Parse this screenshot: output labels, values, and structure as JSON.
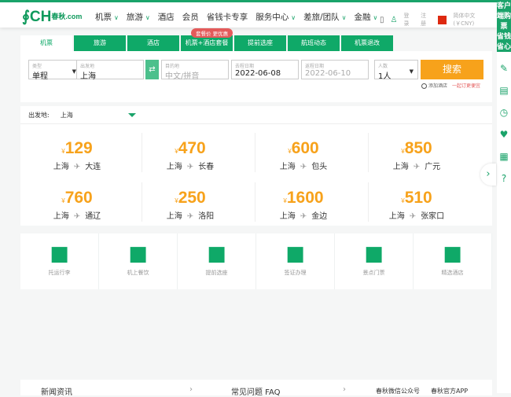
{
  "header": {
    "logo_text": "CH",
    "logo_sub": "春秋.com",
    "nav": [
      {
        "label": "机票",
        "dropdown": true
      },
      {
        "label": "旅游",
        "dropdown": true
      },
      {
        "label": "酒店"
      },
      {
        "label": "会员"
      },
      {
        "label": "省钱卡专享"
      },
      {
        "label": "服务中心",
        "dropdown": true
      },
      {
        "label": "差旅/团队",
        "dropdown": true
      },
      {
        "label": "金融",
        "dropdown": true
      }
    ],
    "login": "登录",
    "register": "注册",
    "language": "简体中文 (￥CNY)"
  },
  "sidebar": {
    "promo": "客户端购票 省钱省心"
  },
  "tabs": [
    {
      "label": "机票",
      "active": true
    },
    {
      "label": "旅游"
    },
    {
      "label": "酒店"
    },
    {
      "label": "机票+酒店套餐"
    },
    {
      "label": "提前选座"
    },
    {
      "label": "航班动态"
    },
    {
      "label": "机票退改"
    }
  ],
  "tab_badge": "套餐价 更优惠",
  "form": {
    "type_label": "类型",
    "type_value": "单程",
    "from_label": "出发地",
    "from_value": "上海",
    "to_label": "目的地",
    "to_placeholder": "中文/拼音",
    "depart_label": "去程日期",
    "depart_value": "2022-06-08",
    "return_label": "返程日期",
    "return_value": "2022-06-10",
    "pax_label": "人数",
    "pax_value": "1人",
    "search": "搜索",
    "add_hotel": "添加酒店",
    "add_hotel_note": "一起订更便宜"
  },
  "deals": {
    "from_label": "出发地:",
    "from_value": "上海",
    "currency": "¥",
    "items": [
      {
        "price": "129",
        "from": "上海",
        "to": "大连"
      },
      {
        "price": "470",
        "from": "上海",
        "to": "长春"
      },
      {
        "price": "600",
        "from": "上海",
        "to": "包头"
      },
      {
        "price": "850",
        "from": "上海",
        "to": "广元"
      },
      {
        "price": "760",
        "from": "上海",
        "to": "通辽"
      },
      {
        "price": "250",
        "from": "上海",
        "to": "洛阳"
      },
      {
        "price": "1600",
        "from": "上海",
        "to": "金边"
      },
      {
        "price": "510",
        "from": "上海",
        "to": "张家口"
      }
    ]
  },
  "services": [
    {
      "label": "托运行李",
      "icon": "luggage-icon"
    },
    {
      "label": "机上餐饮",
      "icon": "utensils-icon"
    },
    {
      "label": "提前选座",
      "icon": "seat-icon"
    },
    {
      "label": "签证办理",
      "icon": "passport-icon"
    },
    {
      "label": "景点门票",
      "icon": "ticket-icon"
    },
    {
      "label": "精选酒店",
      "icon": "hotel-icon"
    }
  ],
  "footer": {
    "news": "新闻资讯",
    "faq": "常见问题 FAQ",
    "wechat": "春秋微信公众号",
    "app": "春秋官方APP"
  }
}
